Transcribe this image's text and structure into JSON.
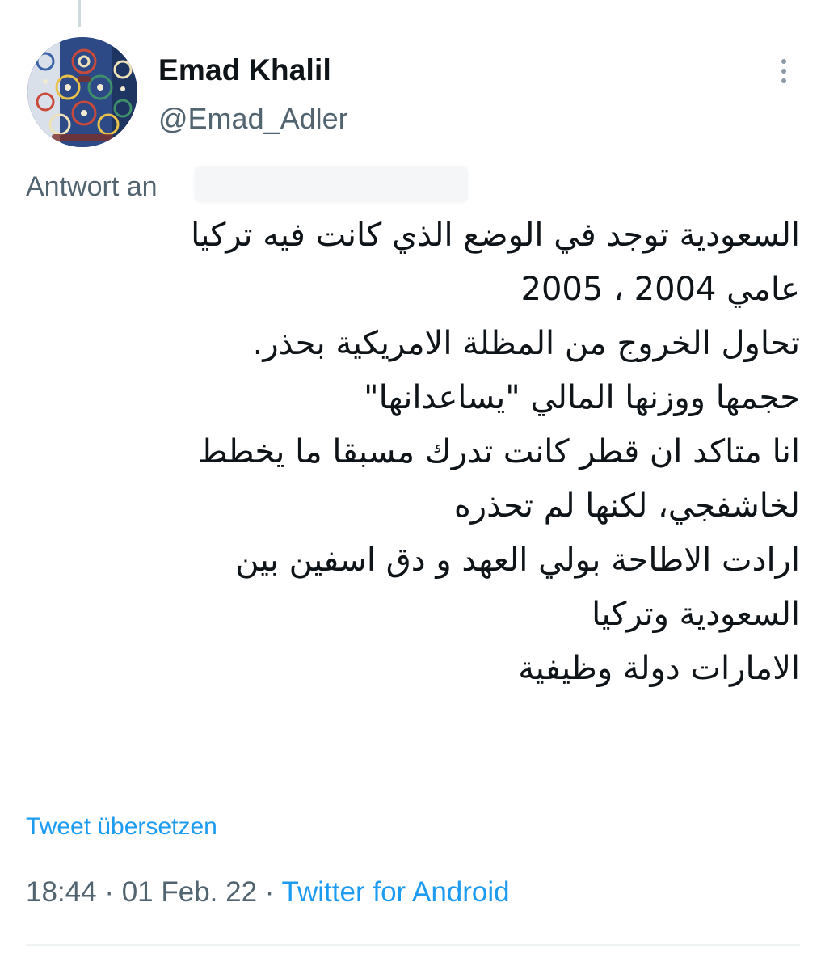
{
  "author": {
    "display_name": "Emad Khalil",
    "handle": "@Emad_Adler",
    "avatar_icon": "mosaic-avatar"
  },
  "reply": {
    "label": "Antwort an"
  },
  "tweet": {
    "lines": [
      "السعودية توجد في الوضع الذي كانت فيه تركيا",
      "عامي 2004 ، 2005",
      "تحاول الخروج من المظلة الامريكية بحذر.",
      "حجمها ووزنها المالي \"يساعدانها\"",
      "انا متاكد ان قطر كانت تدرك مسبقا ما يخطط",
      "لخاشفجي، لكنها لم تحذره",
      "ارادت الاطاحة بولي العهد و دق اسفين بين",
      "السعودية وتركيا",
      "الامارات دولة وظيفية"
    ]
  },
  "translate_label": "Tweet übersetzen",
  "meta": {
    "time": "18:44",
    "separator": "·",
    "date": "01 Feb. 22",
    "source": "Twitter for Android"
  },
  "colors": {
    "accent": "#1d9bf0",
    "secondary_text": "#536471",
    "primary_text": "#0f1419"
  }
}
